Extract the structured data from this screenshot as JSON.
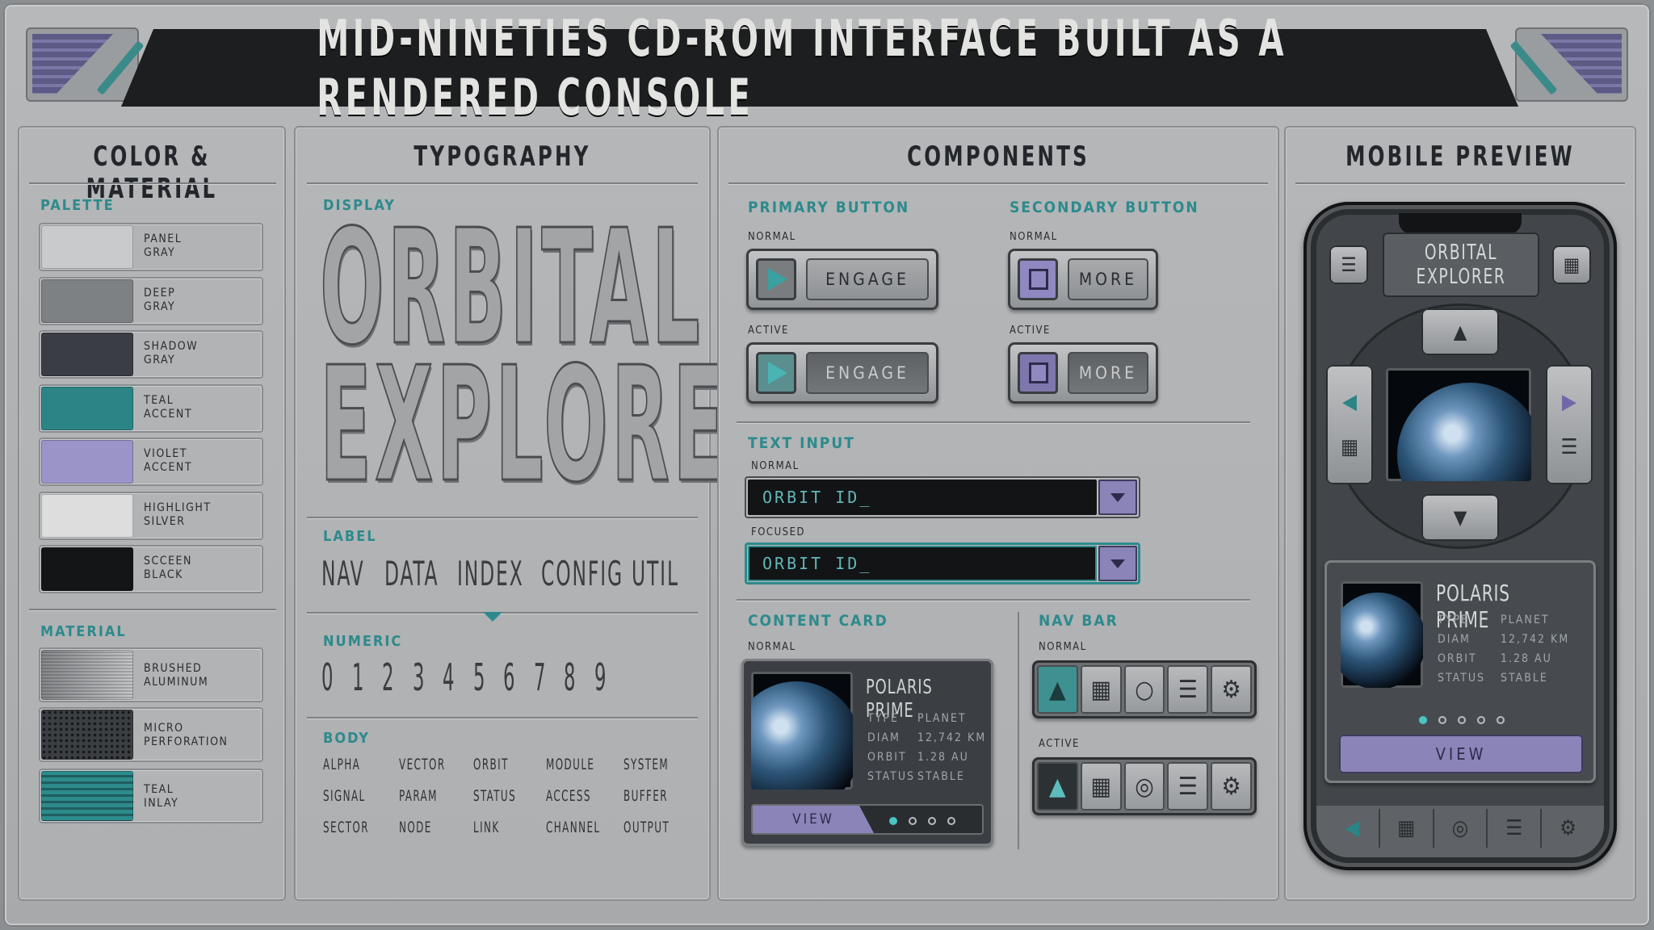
{
  "title": "MID-NINETIES CD-ROM INTERFACE BUILT AS A RENDERED CONSOLE",
  "colors": {
    "panel_gray": "#c9cacb",
    "deep_gray": "#7e8184",
    "shadow_gray": "#3a3e44",
    "teal_accent": "#2c8486",
    "violet_accent": "#9a94c8",
    "highlight_silver": "#dcdddc",
    "screen_black": "#141516"
  },
  "color_material": {
    "heading": "COLOR & MATERIAL",
    "palette_label": "PALETTE",
    "palette": [
      {
        "name": "PANEL\nGRAY",
        "color": "#c9cacb"
      },
      {
        "name": "DEEP\nGRAY",
        "color": "#7e8184"
      },
      {
        "name": "SHADOW\nGRAY",
        "color": "#3a3e44"
      },
      {
        "name": "TEAL\nACCENT",
        "color": "#2c8486"
      },
      {
        "name": "VIOLET\nACCENT",
        "color": "#9a94c8"
      },
      {
        "name": "HIGHLIGHT\nSILVER",
        "color": "#dcdddc"
      },
      {
        "name": "SCCEEN\nBLACK",
        "color": "#141516"
      }
    ],
    "material_label": "MATERIAL",
    "materials": [
      {
        "name": "BRUSHED\nALUMINUM"
      },
      {
        "name": "MICRO\nPERFORATION"
      },
      {
        "name": "TEAL\nINLAY"
      }
    ]
  },
  "typography": {
    "heading": "TYPOGRAPHY",
    "display_label": "DISPLAY",
    "display_line1": "ORBITAL",
    "display_line2": "EXPLORER",
    "label_label": "LABEL",
    "labels": [
      "NAV",
      "DATA",
      "INDEX",
      "CONFIG",
      "UTIL"
    ],
    "numeric_label": "NUMERIC",
    "numerals": [
      "0",
      "1",
      "2",
      "3",
      "4",
      "5",
      "6",
      "7",
      "8",
      "9"
    ],
    "body_label": "BODY",
    "body_words": [
      "ALPHA",
      "VECTOR",
      "ORBIT",
      "MODULE",
      "SYSTEM",
      "SIGNAL",
      "PARAM",
      "STATUS",
      "ACCESS",
      "BUFFER",
      "SECTOR",
      "NODE",
      "LINK",
      "CHANNEL",
      "OUTPUT"
    ]
  },
  "components": {
    "heading": "COMPONENTS",
    "primary_label": "PRIMARY BUTTON",
    "secondary_label": "SECONDARY BUTTON",
    "normal": "NORMAL",
    "active": "ACTIVE",
    "focused": "FOCUSED",
    "engage": "ENGAGE",
    "more": "MORE",
    "text_input_label": "TEXT INPUT",
    "input_value": "ORBIT ID_",
    "content_card_label": "CONTENT CARD",
    "nav_bar_label": "NAV BAR",
    "card": {
      "title": "POLARIS PRIME",
      "rows": [
        [
          "TYPE",
          "PLANET"
        ],
        [
          "DIAM",
          "12,742 KM"
        ],
        [
          "ORBIT",
          "1.28 AU"
        ],
        [
          "STATUS",
          "STABLE"
        ]
      ],
      "view": "VIEW",
      "page_count": 4,
      "active_page": 1
    },
    "nav_icons": [
      "triangle-icon",
      "grid-icon",
      "circle-icon",
      "list-icon",
      "gear-icon"
    ]
  },
  "mobile": {
    "heading": "MOBILE PREVIEW",
    "app_title_line1": "ORBITAL",
    "app_title_line2": "EXPLORER",
    "card": {
      "title": "POLARIS PRIME",
      "rows": [
        [
          "TYPE",
          "PLANET"
        ],
        [
          "DIAM",
          "12,742 KM"
        ],
        [
          "ORBIT",
          "1.28 AU"
        ],
        [
          "STATUS",
          "STABLE"
        ]
      ],
      "view": "VIEW",
      "page_count": 5,
      "active_page": 1
    }
  }
}
